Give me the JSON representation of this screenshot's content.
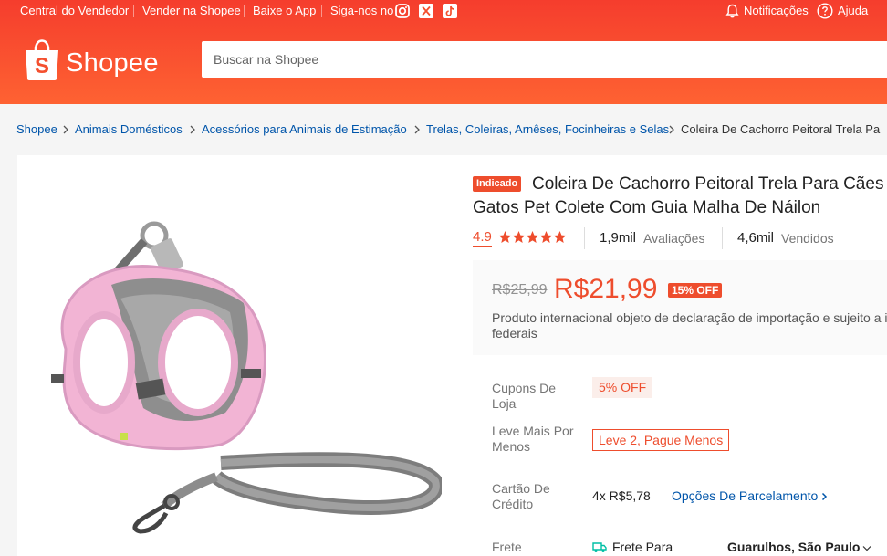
{
  "topbar": {
    "seller_center": "Central do Vendedor",
    "sell": "Vender na Shopee",
    "download": "Baixe o App",
    "follow": "Siga-nos no",
    "notifications": "Notificações",
    "help": "Ajuda"
  },
  "brand": {
    "name": "Shopee"
  },
  "search": {
    "placeholder": "Buscar na Shopee"
  },
  "breadcrumb": [
    "Shopee",
    "Animais Domésticos",
    "Acessórios para Animais de Estimação",
    "Trelas, Coleiras, Arnêses, Focinheiras e Selas",
    "Coleira De Cachorro Peitoral Trela Pa"
  ],
  "product": {
    "badge": "Indicado",
    "title": "Coleira De Cachorro Peitoral Trela Para Cães Gatos Pet Colete Com Guia Malha De Náilon",
    "rating": "4.9",
    "rating_value": 4.9,
    "reviews_count": "1,9mil",
    "reviews_label": "Avaliações",
    "sold_count": "4,6mil",
    "sold_label": "Vendidos",
    "old_price": "R$25,99",
    "price": "R$21,99",
    "discount": "15% OFF",
    "import_note": "Produto internacional objeto de declaração de importação e sujeito a i federais"
  },
  "details": {
    "coupons_label": "Cupons De Loja",
    "coupon": "5% OFF",
    "bundle_label": "Leve Mais Por Menos",
    "bundle": "Leve 2, Pague Menos",
    "card_label": "Cartão De Crédito",
    "installments": "4x R$5,78",
    "installment_options": "Opções De Parcelamento",
    "shipping_label": "Frete",
    "shipping_to": "Frete Para",
    "city": "Guarulhos, São Paulo"
  },
  "colors": {
    "brand": "#ee4d2d",
    "link": "#0055aa"
  }
}
